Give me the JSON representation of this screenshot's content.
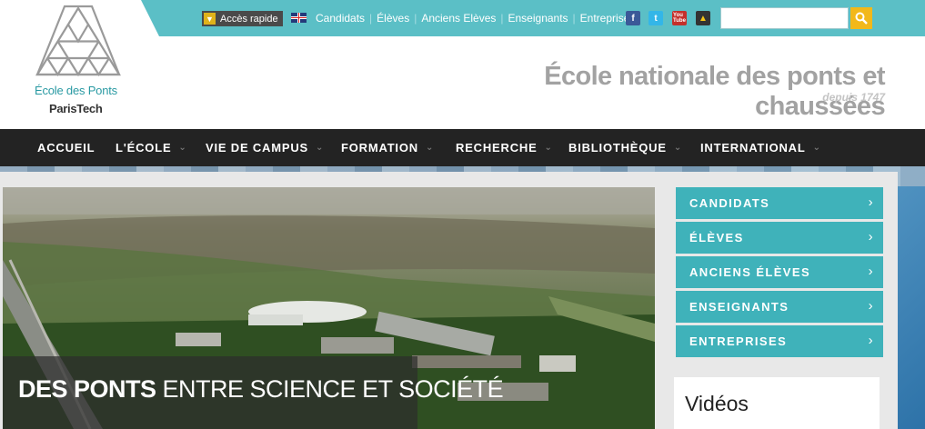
{
  "topbar": {
    "quick_access": "Accès rapide",
    "links": [
      "Candidats",
      "Élèves",
      "Anciens Elèves",
      "Enseignants",
      "Entreprises"
    ],
    "social_icons": [
      "facebook-icon",
      "twitter-icon",
      "youtube-icon",
      "other-social-icon"
    ],
    "search_value": "",
    "search_placeholder": ""
  },
  "header": {
    "logo_line1": "École des Ponts",
    "logo_line2": "ParisTech",
    "title": "École nationale des ponts et chaussées",
    "subtitle": "depuis 1747"
  },
  "nav": {
    "items": [
      {
        "label": "ACCUEIL",
        "dropdown": false
      },
      {
        "label": "L'ÉCOLE",
        "dropdown": true
      },
      {
        "label": "VIE DE CAMPUS",
        "dropdown": true
      },
      {
        "label": "FORMATION",
        "dropdown": true
      },
      {
        "label": "RECHERCHE",
        "dropdown": true
      },
      {
        "label": "BIBLIOTHÈQUE",
        "dropdown": true
      },
      {
        "label": "INTERNATIONAL",
        "dropdown": true
      }
    ]
  },
  "hero": {
    "caption_bold": "DES PONTS",
    "caption_rest": " ENTRE SCIENCE ET SOCIÉTÉ"
  },
  "sidebar": {
    "buttons": [
      "CANDIDATS",
      "ÉLÈVES",
      "ANCIENS ÉLÈVES",
      "ENSEIGNANTS",
      "ENTREPRISES"
    ],
    "videos_title": "Vidéos"
  },
  "colors": {
    "teal": "#5bbfc6",
    "side_button": "#3fb2ba",
    "nav_bg": "#232323",
    "search_button": "#f2b81a"
  }
}
